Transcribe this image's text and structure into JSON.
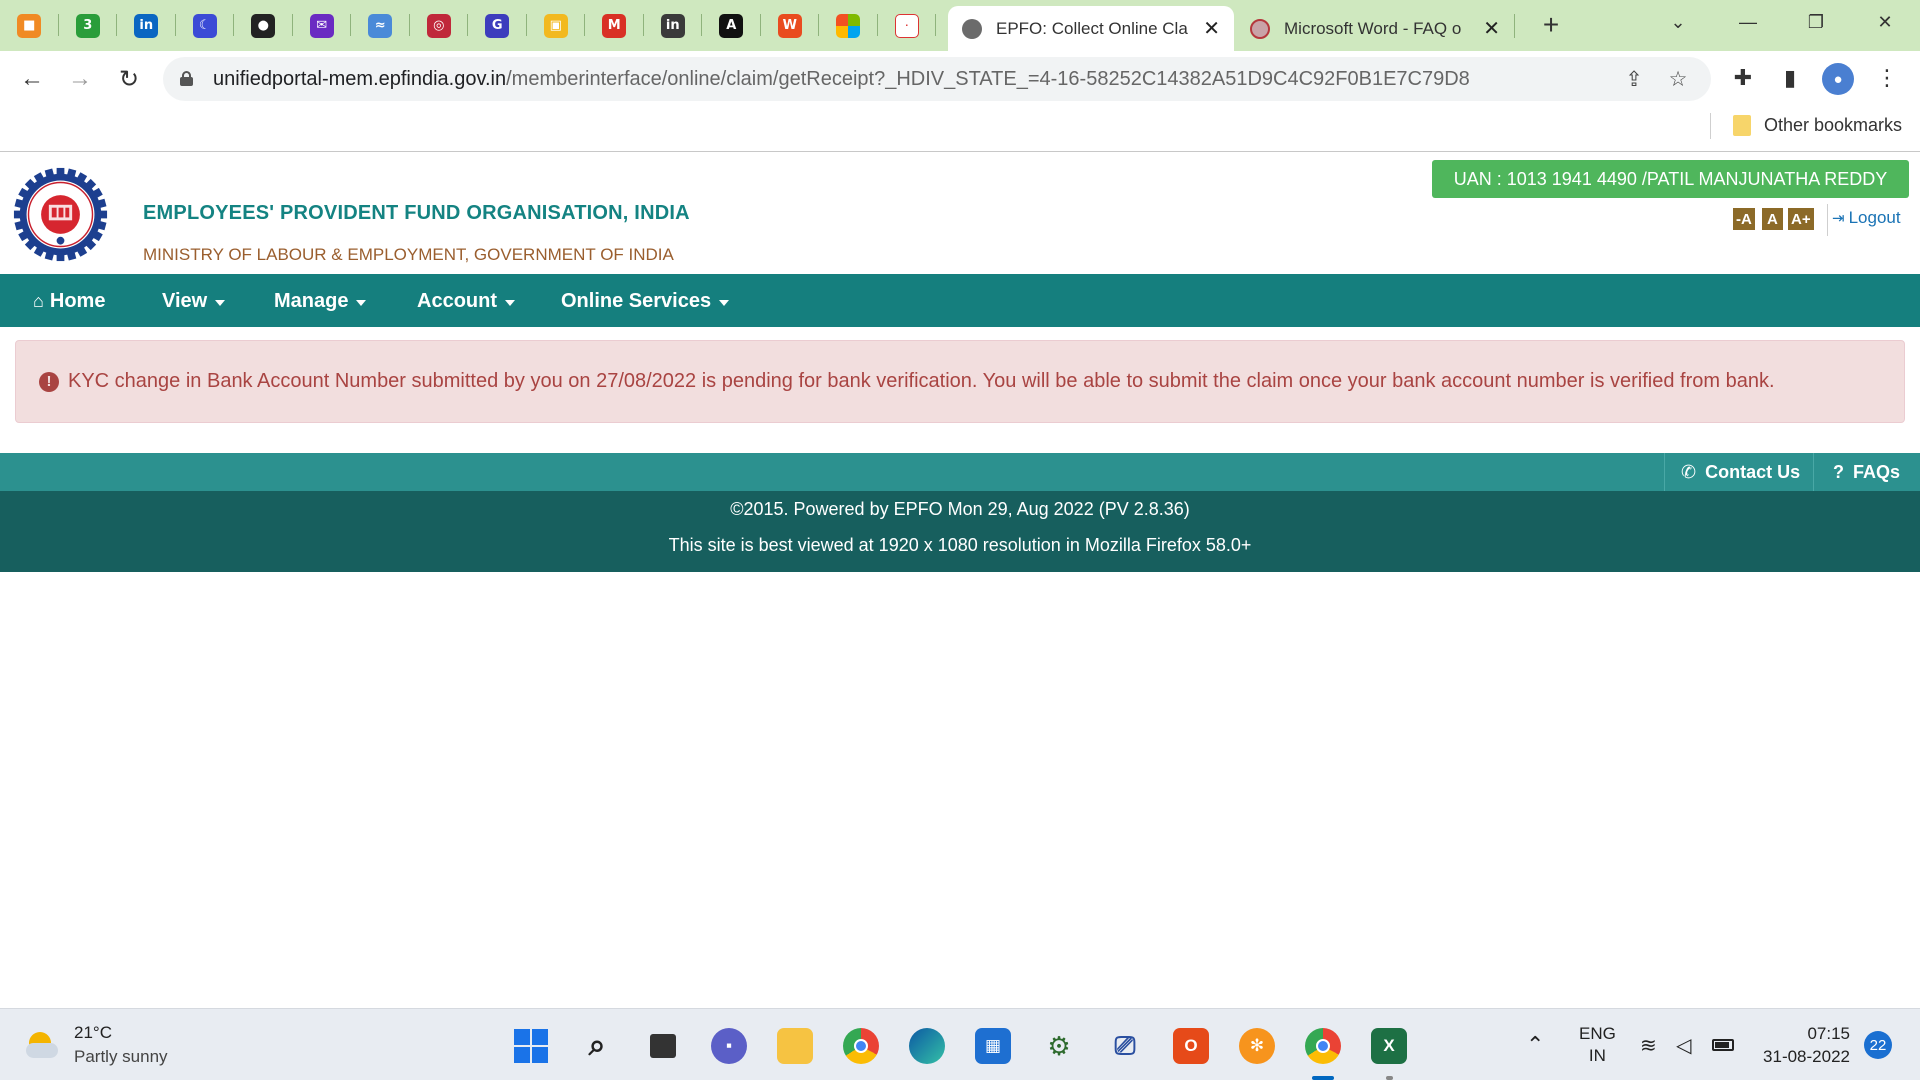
{
  "browser": {
    "pinned_tabs": [
      {
        "icon": "box-icon",
        "color": "#f08a24",
        "glyph": "■"
      },
      {
        "icon": "three-icon",
        "color": "#2a9d3a",
        "glyph": "3"
      },
      {
        "icon": "linkedin-icon",
        "color": "#0a66c2",
        "glyph": "in"
      },
      {
        "icon": "crescent-icon",
        "color": "#3b4bd6",
        "glyph": "☾"
      },
      {
        "icon": "github-icon",
        "color": "#222222",
        "glyph": "●"
      },
      {
        "icon": "mail-icon",
        "color": "#6a2bc2",
        "glyph": "✉"
      },
      {
        "icon": "translate-icon",
        "color": "#4a8ad8",
        "glyph": "≈"
      },
      {
        "icon": "epfo-icon",
        "color": "#c0283a",
        "glyph": "◎"
      },
      {
        "icon": "g-icon",
        "color": "#3d3dbd",
        "glyph": "G"
      },
      {
        "icon": "classroom-icon",
        "color": "#f2b91f",
        "glyph": "▣"
      },
      {
        "icon": "gmail-icon",
        "color": "#d93025",
        "glyph": "M"
      },
      {
        "icon": "invision-icon",
        "color": "#3a3a3a",
        "glyph": "in"
      },
      {
        "icon": "a-icon",
        "color": "#111111",
        "glyph": "A"
      },
      {
        "icon": "jobs-icon",
        "color": "#e94c1f",
        "glyph": "W"
      },
      {
        "icon": "microsoft-icon",
        "color": "#ffffff",
        "glyph": ""
      },
      {
        "icon": "degree-icon",
        "color": "#ffffff",
        "glyph": "·"
      }
    ],
    "tabs": [
      {
        "title": "EPFO: Collect Online Cla",
        "active": true
      },
      {
        "title": "Microsoft Word - FAQ o",
        "active": false
      }
    ],
    "url_domain": "unifiedportal-mem.epfindia.gov.in",
    "url_path": "/memberinterface/online/claim/getReceipt?_HDIV_STATE_=4-16-58252C14382A51D9C4C92F0B1E7C79D8",
    "bookmarks_other": "Other bookmarks"
  },
  "header": {
    "org_name": "EMPLOYEES' PROVIDENT FUND ORGANISATION, INDIA",
    "ministry": "MINISTRY OF LABOUR & EMPLOYMENT, GOVERNMENT OF INDIA",
    "uan": "UAN : 1013 1941 4490 /PATIL MANJUNATHA REDDY",
    "font_small": "-A",
    "font_normal": "A",
    "font_large": "A+",
    "logout": "Logout"
  },
  "nav": {
    "home": "Home",
    "view": "View",
    "manage": "Manage",
    "account": "Account",
    "online_services": "Online Services"
  },
  "alert": {
    "message": "KYC change in Bank Account Number submitted by you on 27/08/2022 is pending for bank verification. You will be able to submit the claim once your bank account number is verified from bank."
  },
  "footer": {
    "contact": "Contact Us",
    "faqs": "FAQs",
    "powered": "©2015. Powered by EPFO Mon 29, Aug 2022 (PV 2.8.36)",
    "best_viewed": "This site is best viewed at 1920 x 1080 resolution in Mozilla Firefox 58.0+"
  },
  "taskbar": {
    "temperature": "21°C",
    "condition": "Partly sunny",
    "lang1": "ENG",
    "lang2": "IN",
    "time": "07:15",
    "date": "31-08-2022",
    "notifications": "22"
  },
  "colors": {
    "teal_nav": "#157f7e",
    "teal_footer": "#175f5e",
    "uan_green": "#4fb65c",
    "alert_text": "#a94442",
    "alert_bg": "#f2dede"
  }
}
